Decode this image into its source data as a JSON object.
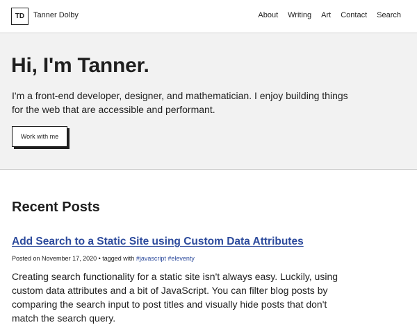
{
  "header": {
    "logo_text": "TD",
    "site_title": "Tanner Dolby",
    "nav": [
      {
        "label": "About"
      },
      {
        "label": "Writing"
      },
      {
        "label": "Art"
      },
      {
        "label": "Contact"
      },
      {
        "label": "Search"
      }
    ]
  },
  "hero": {
    "title": "Hi, I'm Tanner.",
    "intro": "I'm a front-end developer, designer, and mathematician. I enjoy building things for the web that are accessible and performant.",
    "cta_label": "Work with me"
  },
  "recent_posts": {
    "heading": "Recent Posts",
    "posts": [
      {
        "title": "Add Search to a Static Site using Custom Data Attributes",
        "posted_prefix": "Posted on",
        "date": "November 17, 2020",
        "tagged_prefix": "• tagged with",
        "tags": [
          "#javascript",
          "#eleventy"
        ],
        "excerpt": "Creating search functionality for a static site isn't always easy. Luckily, using custom data attributes and a bit of JavaScript. You can filter blog posts by comparing the search input to post titles and visually hide posts that don't match the search query."
      }
    ]
  },
  "colors": {
    "text": "#1f1f1f",
    "link": "#2c4a9c",
    "hero_bg": "#f2f2f2",
    "page_bg": "#ffffff"
  }
}
